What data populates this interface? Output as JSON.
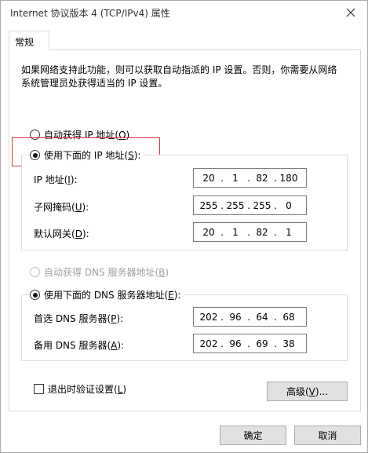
{
  "window": {
    "title": "Internet 协议版本 4 (TCP/IPv4) 属性"
  },
  "tabs": [
    {
      "label": "常规"
    }
  ],
  "description": "如果网络支持此功能，则可以获取自动指派的 IP 设置。否则，你需要从网络系统管理员处获得适当的 IP 设置。",
  "ip_section": {
    "auto_radio": {
      "label_pre": "自动获得 IP 地址(",
      "key": "O",
      "label_post": ")",
      "checked": false
    },
    "manual_radio": {
      "label_pre": "使用下面的 IP 地址(",
      "key": "S",
      "label_post": "):",
      "checked": true
    },
    "fields": [
      {
        "label_pre": "IP 地址(",
        "key": "I",
        "label_post": "):",
        "octets": [
          "20",
          "1",
          "82",
          "180"
        ]
      },
      {
        "label_pre": "子网掩码(",
        "key": "U",
        "label_post": "):",
        "octets": [
          "255",
          "255",
          "255",
          "0"
        ]
      },
      {
        "label_pre": "默认网关(",
        "key": "D",
        "label_post": "):",
        "octets": [
          "20",
          "1",
          "82",
          "1"
        ]
      }
    ]
  },
  "dns_section": {
    "auto_radio": {
      "label_pre": "自动获得 DNS 服务器地址(",
      "key": "B",
      "label_post": ")",
      "checked": false,
      "disabled": true
    },
    "manual_radio": {
      "label_pre": "使用下面的 DNS 服务器地址(",
      "key": "E",
      "label_post": "):",
      "checked": true
    },
    "fields": [
      {
        "label_pre": "首选 DNS 服务器(",
        "key": "P",
        "label_post": "):",
        "octets": [
          "202",
          "96",
          "64",
          "68"
        ]
      },
      {
        "label_pre": "备用 DNS 服务器(",
        "key": "A",
        "label_post": "):",
        "octets": [
          "202",
          "96",
          "69",
          "38"
        ]
      }
    ]
  },
  "validate_checkbox": {
    "label_pre": "退出时验证设置(",
    "key": "L",
    "label_post": ")",
    "checked": false
  },
  "advanced_button": {
    "label_pre": "高级(",
    "key": "V",
    "label_post": ")..."
  },
  "ok_button": {
    "label": "确定"
  },
  "cancel_button": {
    "label": "取消"
  },
  "colors": {
    "highlight": "#d9363e"
  }
}
